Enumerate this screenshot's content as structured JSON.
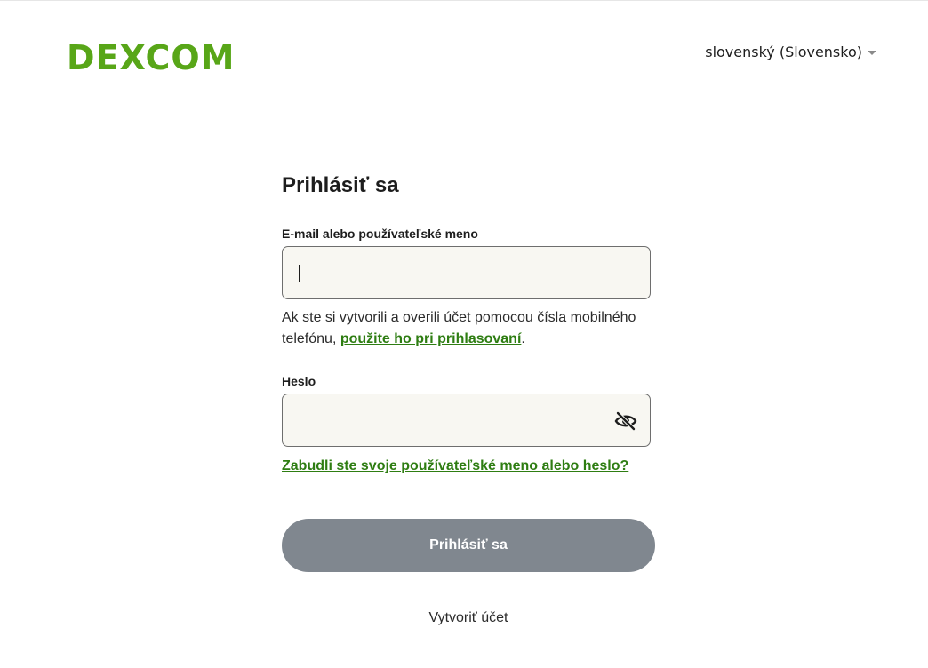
{
  "header": {
    "logo_text": "DEXCOM",
    "language": "slovenský (Slovensko)",
    "brand_color": "#58a618"
  },
  "form": {
    "title": "Prihlásiť sa",
    "username_label": "E-mail alebo používateľské meno",
    "username_value": "",
    "help_text_prefix": "Ak ste si vytvorili a overili účet pomocou čísla mobilného telefónu, ",
    "help_link": "použite ho pri prihlasovaní",
    "help_text_suffix": ".",
    "password_label": "Heslo",
    "password_value": "",
    "password_toggle_icon": "eye-slash-icon",
    "forgot_link": "Zabudli ste svoje používateľské meno alebo heslo?",
    "submit_label": "Prihlásiť sa",
    "create_account": "Vytvoriť účet",
    "link_color": "#2e7d12",
    "button_color": "#80878f"
  }
}
